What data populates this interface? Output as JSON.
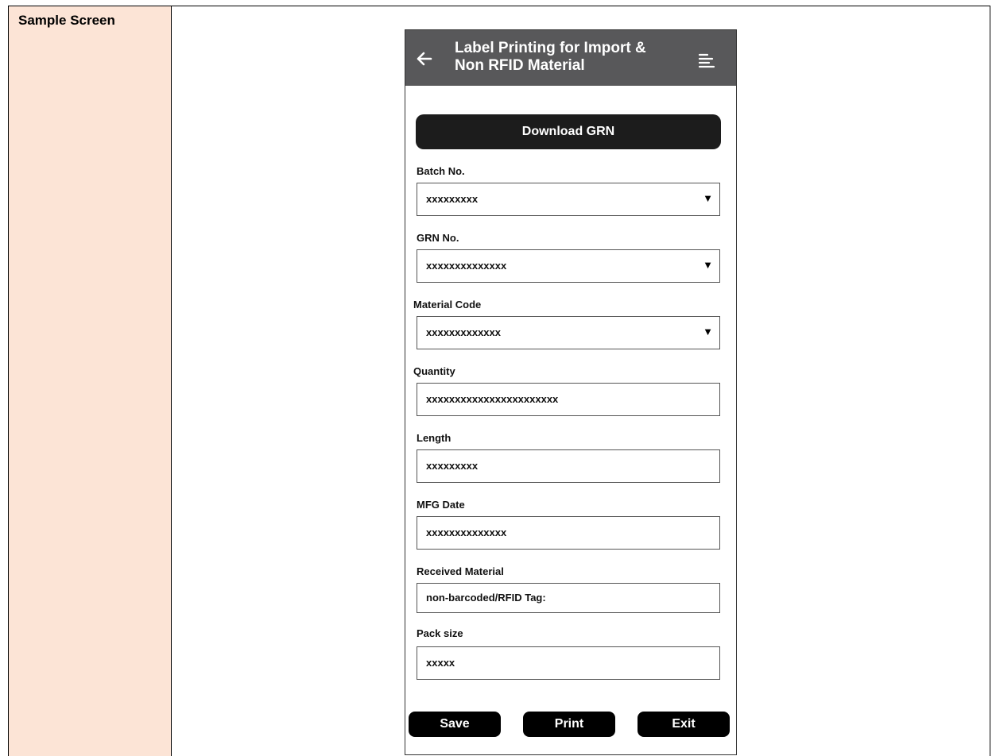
{
  "doc": {
    "label": "Sample Screen"
  },
  "header": {
    "title_line1": "Label Printing for Import &",
    "title_line2": "Non RFID Material"
  },
  "download_button": "Download GRN",
  "fields": {
    "batch": {
      "label": "Batch No.",
      "value": "xxxxxxxxx"
    },
    "grn": {
      "label": "GRN No.",
      "value": "xxxxxxxxxxxxxx"
    },
    "material": {
      "label": "Material Code",
      "value": "xxxxxxxxxxxxx"
    },
    "quantity": {
      "label": "Quantity",
      "value": "xxxxxxxxxxxxxxxxxxxxxxx"
    },
    "length": {
      "label": "Length",
      "value": "xxxxxxxxx"
    },
    "mfg": {
      "label": "MFG Date",
      "value": "xxxxxxxxxxxxxx"
    },
    "received": {
      "label": "Received Material",
      "value": "non-barcoded/RFID Tag:"
    },
    "pack": {
      "label": "Pack size",
      "value": "xxxxx"
    }
  },
  "caret": "▼",
  "buttons": {
    "save": "Save",
    "print": "Print",
    "exit": "Exit"
  }
}
